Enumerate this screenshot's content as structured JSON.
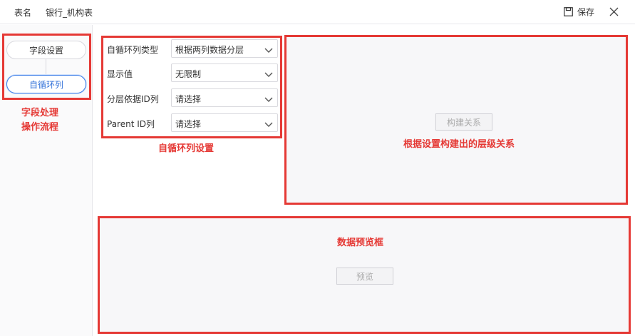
{
  "header": {
    "table_name_label": "表名",
    "table_name_value": "银行_机构表",
    "save_label": "保存"
  },
  "steps": {
    "field_settings": "字段设置",
    "self_loop": "自循环列"
  },
  "form": {
    "loop_type": {
      "label": "自循环列类型",
      "value": "根据两列数据分层"
    },
    "display_value": {
      "label": "显示值",
      "value": "无限制"
    },
    "layer_id": {
      "label": "分层依据ID列",
      "value": "请选择"
    },
    "parent_id": {
      "label": "Parent ID列",
      "value": "请选择"
    }
  },
  "buttons": {
    "build_relation": "构建关系",
    "preview": "预览"
  },
  "annotations": {
    "process_line1": "字段处理",
    "process_line2": "操作流程",
    "loop_settings": "自循环列设置",
    "hierarchy": "根据设置构建出的层级关系",
    "preview_box": "数据预览框"
  },
  "colors": {
    "annotation_red": "#e53935",
    "active_blue": "#3b7de8"
  }
}
